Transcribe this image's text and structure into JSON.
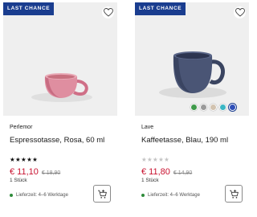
{
  "products": [
    {
      "badge": "LAST CHANCE",
      "brand": "Perlemor",
      "name": "Espressotasse, Rosa, 60 ml",
      "rating_stars": "★★★★★",
      "rating_value": 5,
      "price": "€ 11,10",
      "old_price": "€ 18,90",
      "unit": "1 Stück",
      "delivery": "Lieferzeit: 4–6 Werktage",
      "wishlist_icon": "heart-outline-icon",
      "cart_icon": "add-to-cart-icon"
    },
    {
      "badge": "LAST CHANCE",
      "brand": "Lave",
      "name": "Kaffeetasse, Blau, 190 ml",
      "rating_stars": "★★★★★",
      "rating_value": 0,
      "price": "€ 11,80",
      "old_price": "€ 14,90",
      "unit": "1 Stück",
      "delivery": "Lieferzeit: 4–6 Werktage",
      "wishlist_icon": "heart-outline-icon",
      "cart_icon": "add-to-cart-icon",
      "color_swatches": [
        "#3f9a4a",
        "#9a9a9a",
        "#d2c3b0",
        "#3ab6c4",
        "#2f4fb8"
      ],
      "selected_swatch": 4
    }
  ],
  "colors": {
    "badge_bg": "#1a3d8f",
    "price": "#c8102e",
    "availability_dot": "#2e8b3a"
  }
}
